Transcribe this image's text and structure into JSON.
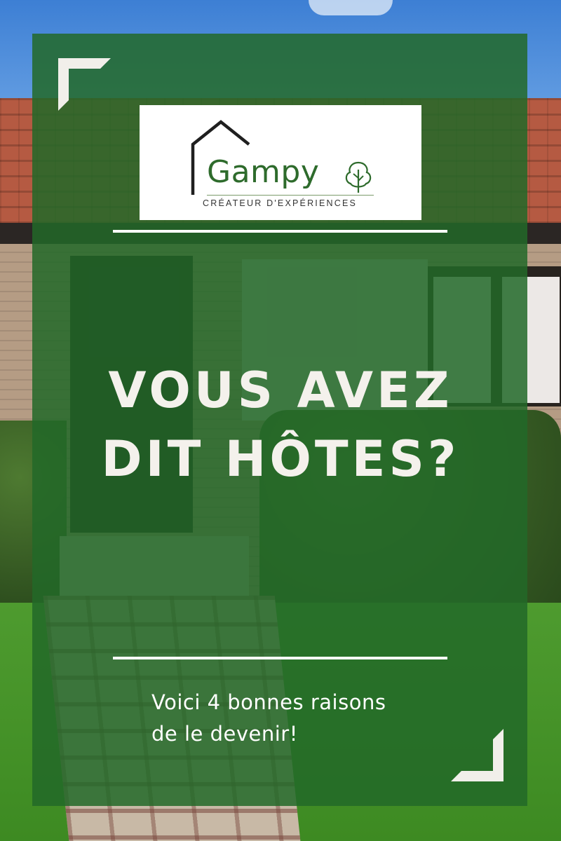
{
  "brand": {
    "name": "Gampy",
    "tagline": "CRÉATEUR D'EXPÉRIENCES",
    "logo_icons": [
      "house-outline-icon",
      "tree-icon"
    ],
    "color": "#2e6b2c"
  },
  "headline": {
    "line1": "VOUS AVEZ",
    "line2": "DIT HÔTES?"
  },
  "subtitle": {
    "line1": "Voici 4 bonnes raisons",
    "line2": "de le devenir!"
  },
  "theme": {
    "overlay_color": "#226828",
    "text_color": "#f4f1ec",
    "accent": "#ffffff"
  }
}
